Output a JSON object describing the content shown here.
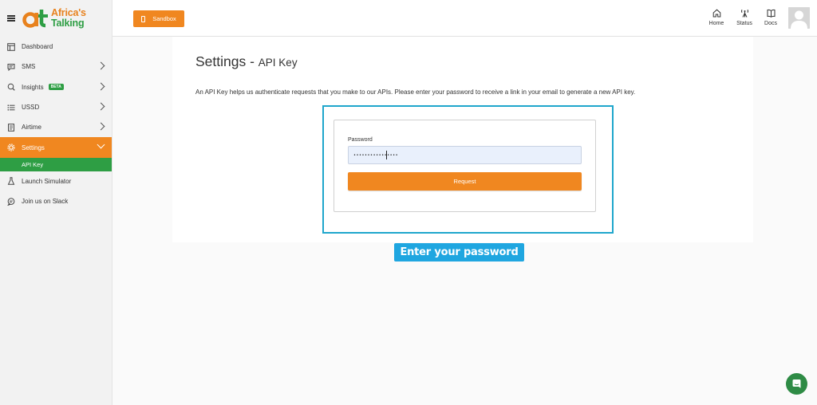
{
  "brand": {
    "line1": "Africa's",
    "line2": "Talking"
  },
  "sidebar": {
    "items": [
      {
        "label": "Dashboard",
        "icon": "dashboard-icon"
      },
      {
        "label": "SMS",
        "icon": "message-icon",
        "chevron": true
      },
      {
        "label": "Insights",
        "icon": "insights-icon",
        "badge": "BETA",
        "chevron": true
      },
      {
        "label": "USSD",
        "icon": "list-icon",
        "chevron": true
      },
      {
        "label": "Airtime",
        "icon": "document-icon",
        "chevron": true
      },
      {
        "label": "Settings",
        "icon": "gear-icon",
        "chevron": true,
        "active": true
      },
      {
        "label": "API Key",
        "sub": true,
        "active": true
      },
      {
        "label": "Launch Simulator",
        "icon": "flask-icon"
      },
      {
        "label": "Join us on Slack",
        "icon": "chat-bubble-icon"
      }
    ]
  },
  "header": {
    "sandbox_label": "Sandbox",
    "links": [
      {
        "label": "Home",
        "icon": "home-icon"
      },
      {
        "label": "Status",
        "icon": "antenna-icon"
      },
      {
        "label": "Docs",
        "icon": "book-icon"
      }
    ]
  },
  "main": {
    "title": "Settings - ",
    "subtitle": "API Key",
    "description": "An API Key helps us authenticate requests that you make to our APIs. Please enter your password to receive a link in your email to generate a new API key.",
    "form": {
      "password_label": "Password",
      "password_value": "••••••••••••••••",
      "request_label": "Request"
    },
    "tooltip": "Enter your password"
  },
  "colors": {
    "orange": "#f08720",
    "green": "#2e9e44",
    "highlight": "#1fa6cc",
    "tooltip": "#1fa6e0"
  }
}
